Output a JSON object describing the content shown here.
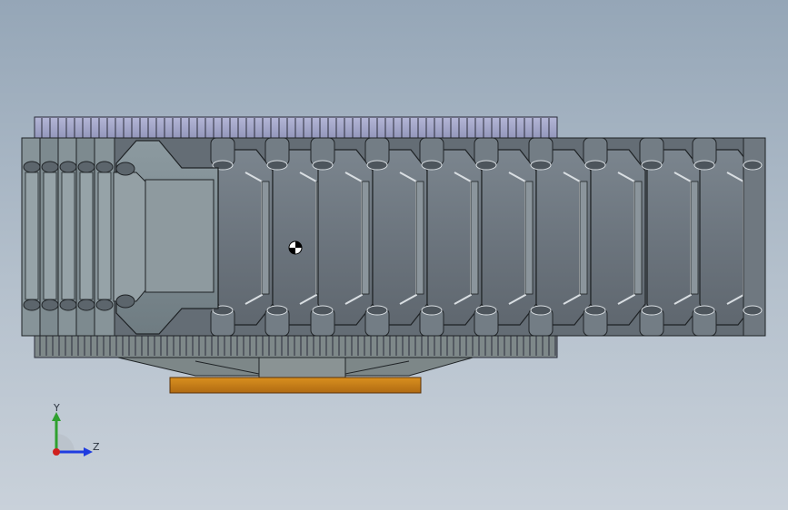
{
  "viewport": {
    "background_top": "#95a6b7",
    "background_bottom": "#c9d1da"
  },
  "model": {
    "part_colors": {
      "link_dark": "#6e7780",
      "link_mid": "#858e97",
      "link_light": "#9aa6ae",
      "edge": "#1f2326",
      "highlight": "#d9dee2",
      "base_plate": "#c87d1c",
      "rear_stack": "#a7a9cc"
    },
    "origin_marker": "origin-marker-icon"
  },
  "triad": {
    "y_label": "Y",
    "z_label": "Z",
    "y_color": "#2fa02f",
    "z_color": "#1f3ce0",
    "x_color": "#d0201e"
  }
}
